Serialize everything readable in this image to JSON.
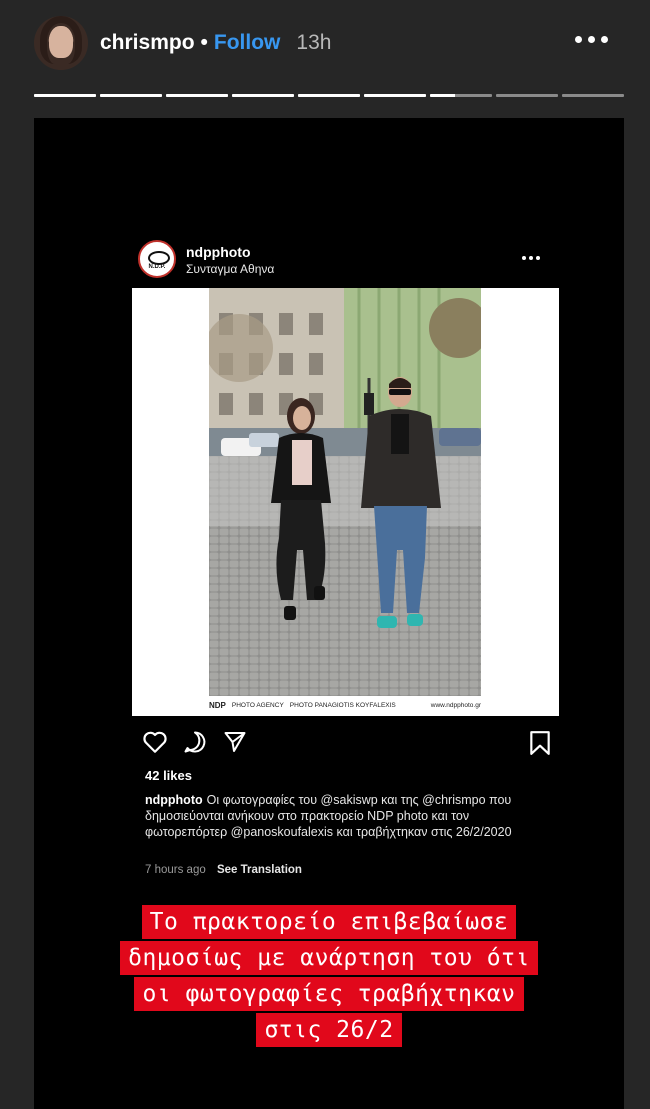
{
  "header": {
    "username": "chrismpo",
    "separator": "•",
    "follow_label": "Follow",
    "time_ago": "13h"
  },
  "progress": {
    "segment_fill": [
      1,
      1,
      1,
      1,
      1,
      1,
      0.4,
      0,
      0
    ]
  },
  "post": {
    "username": "ndpphoto",
    "location": "Συνταγμα Αθηνα",
    "logo_text": "N.D.P.",
    "photo_credits": {
      "agency": "NDP",
      "agency_suffix": "PHOTO AGENCY",
      "photographer": "PHOTO PANAGIOTIS KOYFALEXIS",
      "website": "www.ndpphoto.gr"
    },
    "likes": "42 likes",
    "caption_user": "ndpphoto",
    "caption_text": "Οι φωτογραφίες του @sakiswp και της @chrismpo που δημοσιεύονται ανήκουν στο πρακτορείο NDP photo και τον φωτορεπόρτερ @panoskoufalexis και τραβήχτηκαν στις 26/2/2020",
    "time_ago": "7 hours ago",
    "see_translation": "See Translation"
  },
  "overlay_text": {
    "line1": "Το πρακτορείο επιβεβαίωσε",
    "line2": "δημοσίως με ανάρτηση του ότι",
    "line3": "οι φωτογραφίες τραβήχτηκαν",
    "line4": "στις 26/2"
  },
  "icons": {
    "more": "more-options-icon",
    "like": "heart-icon",
    "comment": "comment-icon",
    "share": "paper-plane-icon",
    "save": "bookmark-icon"
  },
  "colors": {
    "follow": "#3897f0",
    "overlay_bg": "#e1081b",
    "story_bg": "#000000",
    "page_bg": "#262626"
  }
}
